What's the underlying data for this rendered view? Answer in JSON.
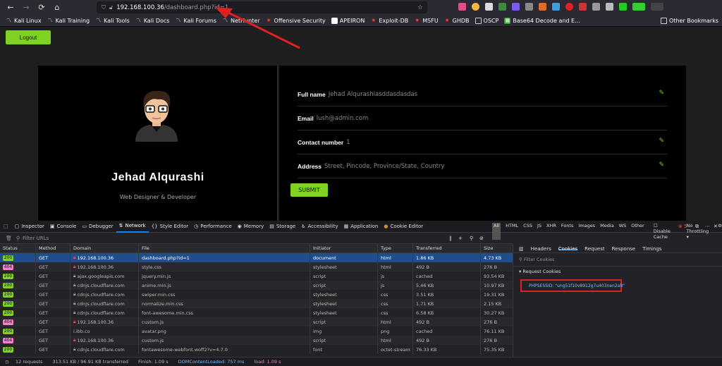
{
  "browser": {
    "url_host": "192.168.100.36",
    "url_path": "/dashboard.php?id=1",
    "bookmarks": [
      "Kali Linux",
      "Kali Training",
      "Kali Tools",
      "Kali Docs",
      "Kali Forums",
      "NetHunter",
      "Offensive Security",
      "APEIRON",
      "Exploit-DB",
      "MSFU",
      "GHDB",
      "OSCP",
      "Base64 Decode and E..."
    ],
    "other_bookmarks": "Other Bookmarks"
  },
  "page": {
    "logout_label": "Logout",
    "profile": {
      "name": "Jehad Alqurashi",
      "role": "Web Designer & Developer"
    },
    "fields": [
      {
        "label": "Full name",
        "value": "Jehad Alqurashiasddasdasdas"
      },
      {
        "label": "Email",
        "value": "lush@admin.com"
      },
      {
        "label": "Contact number",
        "value": "1"
      },
      {
        "label": "Address",
        "value": "Street, Pincode, Province/State, Country"
      }
    ],
    "submit_label": "SUBMIT"
  },
  "devtools": {
    "tabs": [
      "Inspector",
      "Console",
      "Debugger",
      "Network",
      "Style Editor",
      "Performance",
      "Memory",
      "Storage",
      "Accessibility",
      "Application",
      "Cookie Editor"
    ],
    "active_tab": "Network",
    "error_count": "5",
    "filter_placeholder": "Filter URLs",
    "type_filters": [
      "All",
      "HTML",
      "CSS",
      "JS",
      "XHR",
      "Fonts",
      "Images",
      "Media",
      "WS",
      "Other"
    ],
    "disable_cache": "Disable Cache",
    "throttling": "No Throttling",
    "columns": [
      "Status",
      "Method",
      "Domain",
      "File",
      "Initiator",
      "Type",
      "Transferred",
      "Size"
    ],
    "requests": [
      {
        "status": "200",
        "method": "GET",
        "domain": "192.168.100.36",
        "file": "dashboard.php?id=1",
        "initiator": "document",
        "type": "html",
        "transferred": "1.86 KB",
        "size": "4.73 KB",
        "selected": true
      },
      {
        "status": "404",
        "method": "GET",
        "domain": "192.168.100.36",
        "file": "style.css",
        "initiator": "stylesheet",
        "type": "html",
        "transferred": "492 B",
        "size": "276 B"
      },
      {
        "status": "200",
        "method": "GET",
        "domain": "ajax.googleapis.com",
        "file": "jquery.min.js",
        "initiator": "script",
        "type": "js",
        "transferred": "cached",
        "size": "93.54 KB"
      },
      {
        "status": "200",
        "method": "GET",
        "domain": "cdnjs.cloudflare.com",
        "file": "anime.min.js",
        "initiator": "script",
        "type": "js",
        "transferred": "5.46 KB",
        "size": "10.97 KB"
      },
      {
        "status": "200",
        "method": "GET",
        "domain": "cdnjs.cloudflare.com",
        "file": "swiper.min.css",
        "initiator": "stylesheet",
        "type": "css",
        "transferred": "3.51 KB",
        "size": "19.31 KB"
      },
      {
        "status": "200",
        "method": "GET",
        "domain": "cdnjs.cloudflare.com",
        "file": "normalize.min.css",
        "initiator": "stylesheet",
        "type": "css",
        "transferred": "1.71 KB",
        "size": "2.15 KB"
      },
      {
        "status": "200",
        "method": "GET",
        "domain": "cdnjs.cloudflare.com",
        "file": "font-awesome.min.css",
        "initiator": "stylesheet",
        "type": "css",
        "transferred": "6.58 KB",
        "size": "30.27 KB"
      },
      {
        "status": "404",
        "method": "GET",
        "domain": "192.168.100.36",
        "file": "custom.js",
        "initiator": "script",
        "type": "html",
        "transferred": "492 B",
        "size": "276 B"
      },
      {
        "status": "200",
        "method": "GET",
        "domain": "i.ibb.co",
        "file": "avatar.png",
        "initiator": "img",
        "type": "png",
        "transferred": "cached",
        "size": "76.11 KB"
      },
      {
        "status": "404",
        "method": "GET",
        "domain": "192.168.100.36",
        "file": "custom.js",
        "initiator": "script",
        "type": "html",
        "transferred": "492 B",
        "size": "276 B"
      },
      {
        "status": "200",
        "method": "GET",
        "domain": "cdnjs.cloudflare.com",
        "file": "fontawesome-webfont.woff2?v=4.7.0",
        "initiator": "font",
        "type": "octet-stream",
        "transferred": "76.33 KB",
        "size": "75.35 KB"
      }
    ],
    "detail_tabs": [
      "Headers",
      "Cookies",
      "Request",
      "Response",
      "Timings"
    ],
    "active_detail_tab": "Cookies",
    "filter_cookies_placeholder": "Filter Cookies",
    "request_cookies_label": "Request Cookies",
    "cookie": "PHPSESSID: \"ung51f10v8912g7u403nen2a8\"",
    "summary": {
      "requests": "12 requests",
      "transferred": "313.51 KB / 96.91 KB transferred",
      "finish": "Finish: 1.09 s",
      "dom": "DOMContentLoaded: 757 ms",
      "load": "load: 1.09 s"
    }
  },
  "colors": {
    "accent_green": "#7ed321",
    "highlight_red": "#e02020",
    "selected_blue": "#204e8a"
  }
}
